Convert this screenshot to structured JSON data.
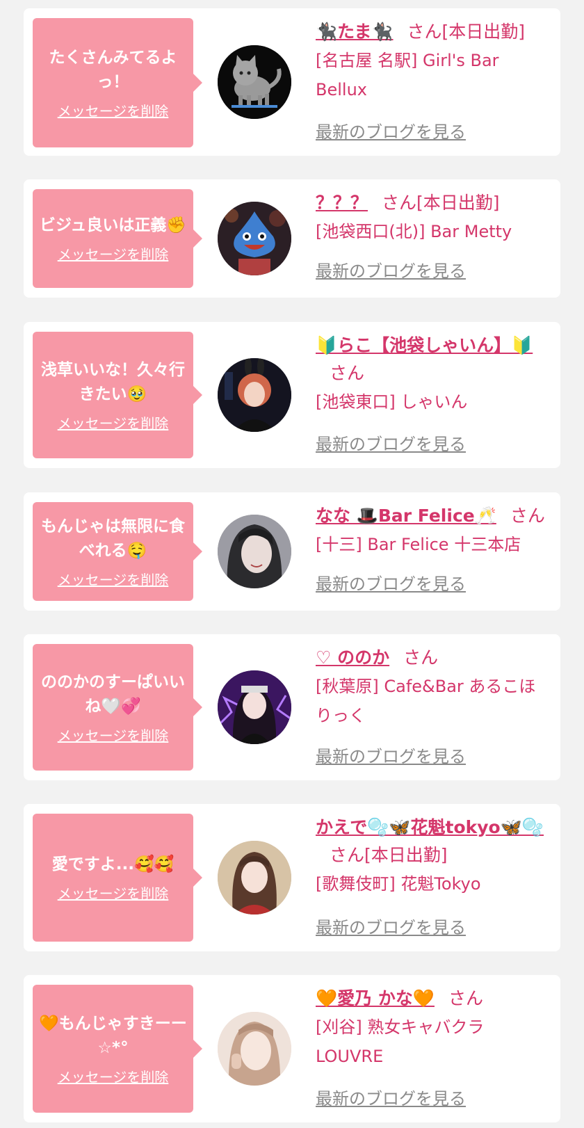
{
  "common": {
    "delete_label": "メッセージを削除",
    "blog_label": "最新のブログを見る",
    "san": "さん"
  },
  "items": [
    {
      "message": "たくさんみてるよっ！",
      "name": "🐈‍⬛たま🐈‍⬛",
      "suffix": "さん[本日出勤]",
      "store": "[名古屋 名駅] Girl's Bar Bellux"
    },
    {
      "message": "ビジュ良いは正義✊",
      "name": "？？？",
      "suffix": "さん[本日出勤]",
      "store": "[池袋西口(北)] Bar Metty"
    },
    {
      "message": "浅草いいな！久々行きたい🥹",
      "name": "🔰らこ【池袋しゃいん】🔰",
      "suffix": "さん",
      "store": "[池袋東口] しゃいん"
    },
    {
      "message": "もんじゃは無限に食べれる🤤",
      "name": "なな 🎩Bar Felice🥂",
      "suffix": "さん",
      "store": "[十三] Bar Felice 十三本店"
    },
    {
      "message": "ののかのすーぱいいね🤍💞",
      "name": "♡ ののか",
      "suffix": "さん",
      "store": "[秋葉原] Cafe&Bar あるこほりっく"
    },
    {
      "message": "愛ですよ...🥰🥰",
      "name": "かえで🫧🦋花魁tokyo🦋🫧",
      "suffix": "さん[本日出勤]",
      "store": "[歌舞伎町] 花魁Tokyo"
    },
    {
      "message": "🧡もんじゃすきーー☆*°",
      "name": "🧡愛乃 かな🧡",
      "suffix": "さん",
      "store": "[刈谷] 熟女キャバクラ LOUVRE"
    }
  ]
}
